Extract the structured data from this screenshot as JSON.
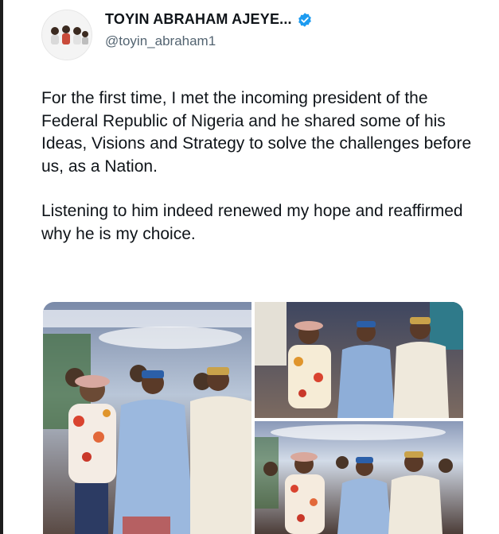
{
  "author": {
    "display_name": "TOYIN ABRAHAM AJEYE...",
    "handle": "@toyin_abraham1",
    "verified_color": "#1d9bf0"
  },
  "tweet": {
    "paragraph_1": "For the first time, I met the incoming president of the Federal Republic of Nigeria and he shared some of his Ideas, Visions and Strategy to solve the challenges before us, as a Nation.",
    "paragraph_2": "Listening to him indeed renewed my hope and reaffirmed why he is my choice."
  },
  "icons": {
    "verified": "verified-badge-icon"
  },
  "colors": {
    "text": "#0f1419",
    "secondary": "#536471"
  }
}
